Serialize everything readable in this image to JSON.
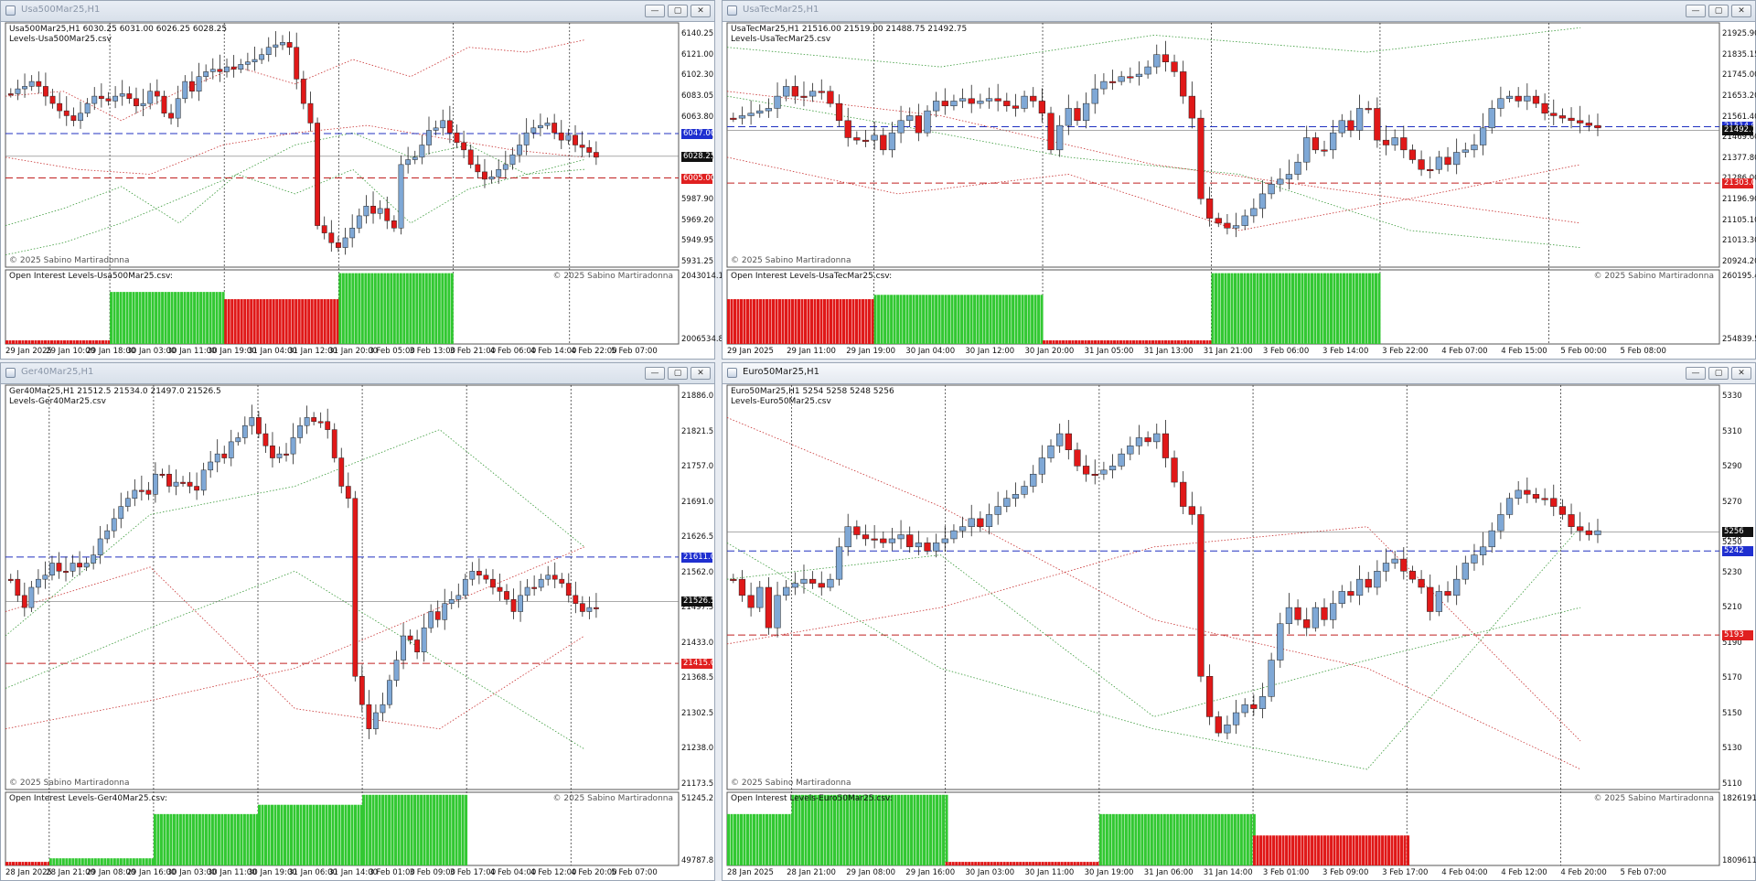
{
  "app": {
    "background": "#e8ecf2",
    "up_color": "#32c832",
    "down_color": "#e01818",
    "candle_up": "#7fa8d6"
  },
  "windows": [
    {
      "id": "usa500",
      "title": "Usa500Mar25,H1",
      "active": false,
      "price_header": "Usa500Mar25,H1  6030.25 6031.00 6026.25 6028.25",
      "levels_label": "Levels-Usa500Mar25.csv",
      "copyright": "© 2025 Sabino Martiradonna",
      "oi_label": "Open Interest Levels-Usa500Mar25.csv:",
      "oi_copyright": "© 2025 Sabino Martiradonna",
      "price_scale": [
        "6140.25",
        "6121.00",
        "6102.30",
        "6083.05",
        "6063.80",
        "6044.55",
        "6025.30",
        "6005.00",
        "5987.90",
        "5969.20",
        "5949.95",
        "5931.25"
      ],
      "oi_scale": [
        "2043014.1",
        "2006534.8"
      ],
      "tags": [
        {
          "text": "6047.00",
          "color": "blue",
          "pos": 0.453
        },
        {
          "text": "6028.25",
          "color": "black",
          "pos": 0.546
        },
        {
          "text": "6005.00",
          "color": "red",
          "pos": 0.635
        }
      ],
      "time_labels": [
        "29 Jan 2025",
        "29 Jan 10:00",
        "29 Jan 18:00",
        "30 Jan 03:00",
        "30 Jan 11:00",
        "30 Jan 19:00",
        "31 Jan 04:00",
        "31 Jan 12:00",
        "31 Jan 20:00",
        "3 Feb 05:00",
        "3 Feb 13:00",
        "3 Feb 21:00",
        "4 Feb 06:00",
        "4 Feb 14:00",
        "4 Feb 22:00",
        "5 Feb 07:00"
      ],
      "session_lines": [
        0.155,
        0.325,
        0.495,
        0.665,
        0.838
      ],
      "blue_dash": 0.453,
      "red_dash": 0.635,
      "current_line": 0.546,
      "oi_bars": [
        {
          "from": 0.0,
          "to": 0.155,
          "color": "red",
          "level": 0.05
        },
        {
          "from": 0.155,
          "to": 0.325,
          "color": "green",
          "level": 0.72
        },
        {
          "from": 0.325,
          "to": 0.495,
          "color": "red",
          "level": 0.62
        },
        {
          "from": 0.495,
          "to": 0.665,
          "color": "green",
          "level": 0.98
        }
      ],
      "segments": [
        [
          0.83,
          0.76,
          0.67,
          0.82,
          0.62,
          0.7,
          0.6,
          0.82,
          0.68,
          0.62,
          0.6
        ],
        [
          0.3,
          0.28,
          0.4,
          0.28,
          0.18,
          0.25,
          0.15,
          0.22,
          0.1,
          0.12,
          0.07
        ],
        [
          0.95,
          0.9,
          0.82,
          0.72,
          0.62,
          0.5,
          0.45,
          0.55,
          0.5,
          0.62,
          0.56
        ],
        [
          0.55,
          0.6,
          0.62,
          0.5,
          0.45,
          0.42,
          0.47,
          0.52,
          0.55
        ]
      ],
      "candles": [
        0.29,
        0.27,
        0.26,
        0.24,
        0.26,
        0.3,
        0.33,
        0.36,
        0.38,
        0.4,
        0.37,
        0.33,
        0.3,
        0.31,
        0.32,
        0.3,
        0.29,
        0.31,
        0.34,
        0.33,
        0.28,
        0.3,
        0.37,
        0.39,
        0.31,
        0.24,
        0.28,
        0.22,
        0.2,
        0.19,
        0.2,
        0.18,
        0.19,
        0.17,
        0.16,
        0.15,
        0.13,
        0.1,
        0.09,
        0.08,
        0.1,
        0.23,
        0.33,
        0.41,
        0.83,
        0.86,
        0.9,
        0.92,
        0.88,
        0.84,
        0.79,
        0.75,
        0.78,
        0.76,
        0.81,
        0.84,
        0.58,
        0.56,
        0.55,
        0.5,
        0.44,
        0.43,
        0.4,
        0.45,
        0.49,
        0.52,
        0.58,
        0.61,
        0.64,
        0.63,
        0.6,
        0.58,
        0.54,
        0.5,
        0.45,
        0.43,
        0.42,
        0.41,
        0.45,
        0.48,
        0.46,
        0.5,
        0.51,
        0.53,
        0.55
      ]
    },
    {
      "id": "usatec",
      "title": "UsaTecMar25,H1",
      "active": false,
      "price_header": "UsaTecMar25,H1  21516.00 21519.00 21488.75 21492.75",
      "levels_label": "Levels-UsaTecMar25.csv",
      "copyright": "© 2025 Sabino Martiradonna",
      "oi_label": "Open Interest Levels-UsaTecMar25.csv:",
      "oi_copyright": "© 2025 Sabino Martiradonna",
      "price_scale": [
        "21925.90",
        "21835.15",
        "21745.00",
        "21653.20",
        "21561.40",
        "21469.60",
        "21377.80",
        "21286.00",
        "21196.90",
        "21105.10",
        "21013.30",
        "20924.20"
      ],
      "oi_scale": [
        "260195.45",
        "254839.55"
      ],
      "tags": [
        {
          "text": "21514.00",
          "color": "blue",
          "pos": 0.425
        },
        {
          "text": "21492.75",
          "color": "black",
          "pos": 0.44
        },
        {
          "text": "21303.00",
          "color": "red",
          "pos": 0.656
        }
      ],
      "time_labels": [
        "29 Jan 2025",
        "29 Jan 11:00",
        "29 Jan 19:00",
        "30 Jan 04:00",
        "30 Jan 12:00",
        "30 Jan 20:00",
        "31 Jan 05:00",
        "31 Jan 13:00",
        "31 Jan 21:00",
        "3 Feb 06:00",
        "3 Feb 14:00",
        "3 Feb 22:00",
        "4 Feb 07:00",
        "4 Feb 15:00",
        "5 Feb 00:00",
        "5 Feb 08:00"
      ],
      "session_lines": [
        0.148,
        0.318,
        0.488,
        0.658,
        0.828
      ],
      "blue_dash": 0.425,
      "red_dash": 0.656,
      "current_line": 0.44,
      "oi_bars": [
        {
          "from": 0.0,
          "to": 0.148,
          "color": "red",
          "level": 0.62
        },
        {
          "from": 0.148,
          "to": 0.318,
          "color": "green",
          "level": 0.68
        },
        {
          "from": 0.318,
          "to": 0.488,
          "color": "red",
          "level": 0.05
        },
        {
          "from": 0.488,
          "to": 0.658,
          "color": "green",
          "level": 0.98
        }
      ],
      "segments": [
        [
          0.1,
          0.18,
          0.05,
          0.12,
          0.02
        ],
        [
          0.55,
          0.7,
          0.62,
          0.85,
          0.72,
          0.58
        ],
        [
          0.3,
          0.42,
          0.55,
          0.62,
          0.85,
          0.92
        ],
        [
          0.28,
          0.38,
          0.58,
          0.7,
          0.82
        ]
      ],
      "candles": [
        0.39,
        0.38,
        0.37,
        0.36,
        0.35,
        0.3,
        0.26,
        0.3,
        0.3,
        0.28,
        0.28,
        0.33,
        0.4,
        0.47,
        0.48,
        0.48,
        0.46,
        0.52,
        0.45,
        0.4,
        0.38,
        0.45,
        0.36,
        0.32,
        0.34,
        0.32,
        0.31,
        0.33,
        0.32,
        0.31,
        0.32,
        0.34,
        0.35,
        0.3,
        0.32,
        0.37,
        0.52,
        0.42,
        0.35,
        0.4,
        0.33,
        0.27,
        0.24,
        0.24,
        0.22,
        0.22,
        0.21,
        0.18,
        0.13,
        0.16,
        0.2,
        0.3,
        0.39,
        0.72,
        0.8,
        0.82,
        0.84,
        0.83,
        0.79,
        0.76,
        0.7,
        0.66,
        0.64,
        0.62,
        0.57,
        0.47,
        0.52,
        0.52,
        0.45,
        0.4,
        0.44,
        0.35,
        0.35,
        0.48,
        0.5,
        0.47,
        0.52,
        0.56,
        0.6,
        0.6,
        0.55,
        0.58,
        0.53,
        0.52,
        0.5,
        0.43,
        0.35,
        0.31,
        0.3,
        0.32,
        0.3,
        0.33,
        0.37,
        0.38,
        0.39,
        0.4,
        0.41,
        0.42,
        0.43
      ]
    },
    {
      "id": "ger40",
      "title": "Ger40Mar25,H1",
      "active": false,
      "price_header": "Ger40Mar25,H1  21512.5 21534.0 21497.0 21526.5",
      "levels_label": "Levels-Ger40Mar25.csv",
      "copyright": "© 2025 Sabino Martiradonna",
      "oi_label": "Open Interest Levels-Ger40Mar25.csv:",
      "oi_copyright": "© 2025 Sabino Martiradonna",
      "price_scale": [
        "21886.0",
        "21821.5",
        "21757.0",
        "21691.0",
        "21626.5",
        "21562.0",
        "21497.5",
        "21433.0",
        "21368.5",
        "21302.5",
        "21238.0",
        "21173.5"
      ],
      "oi_scale": [
        "51245.2",
        "49787.8"
      ],
      "tags": [
        {
          "text": "21611.0",
          "color": "blue",
          "pos": 0.425
        },
        {
          "text": "21526.5",
          "color": "black",
          "pos": 0.535
        },
        {
          "text": "21415.0",
          "color": "red",
          "pos": 0.688
        }
      ],
      "time_labels": [
        "28 Jan 2025",
        "28 Jan 21:00",
        "29 Jan 08:00",
        "29 Jan 16:00",
        "30 Jan 03:00",
        "30 Jan 11:00",
        "30 Jan 19:00",
        "31 Jan 06:00",
        "31 Jan 14:00",
        "3 Feb 01:00",
        "3 Feb 09:00",
        "3 Feb 17:00",
        "4 Feb 04:00",
        "4 Feb 12:00",
        "4 Feb 20:00",
        "5 Feb 07:00"
      ],
      "session_lines": [
        0.065,
        0.22,
        0.375,
        0.53,
        0.685,
        0.84
      ],
      "blue_dash": 0.425,
      "red_dash": 0.688,
      "current_line": 0.535,
      "oi_bars": [
        {
          "from": 0.0,
          "to": 0.065,
          "color": "red",
          "level": 0.05
        },
        {
          "from": 0.065,
          "to": 0.22,
          "color": "green",
          "level": 0.1
        },
        {
          "from": 0.22,
          "to": 0.375,
          "color": "green",
          "level": 0.72
        },
        {
          "from": 0.375,
          "to": 0.53,
          "color": "green",
          "level": 0.85
        },
        {
          "from": 0.53,
          "to": 0.685,
          "color": "green",
          "level": 0.99
        }
      ],
      "segments": [
        [
          0.62,
          0.32,
          0.25,
          0.11,
          0.4
        ],
        [
          0.85,
          0.78,
          0.7,
          0.55,
          0.4
        ],
        [
          0.75,
          0.6,
          0.46,
          0.68,
          0.9
        ],
        [
          0.56,
          0.45,
          0.8,
          0.85,
          0.62
        ]
      ],
      "candles": [
        0.48,
        0.52,
        0.55,
        0.5,
        0.48,
        0.47,
        0.44,
        0.46,
        0.46,
        0.44,
        0.45,
        0.44,
        0.42,
        0.38,
        0.36,
        0.33,
        0.3,
        0.28,
        0.26,
        0.26,
        0.27,
        0.22,
        0.22,
        0.25,
        0.24,
        0.24,
        0.25,
        0.26,
        0.21,
        0.19,
        0.17,
        0.18,
        0.14,
        0.13,
        0.1,
        0.08,
        0.12,
        0.15,
        0.18,
        0.17,
        0.17,
        0.13,
        0.1,
        0.08,
        0.09,
        0.09,
        0.11,
        0.18,
        0.25,
        0.28,
        0.72,
        0.79,
        0.85,
        0.81,
        0.79,
        0.73,
        0.68,
        0.62,
        0.63,
        0.66,
        0.6,
        0.56,
        0.58,
        0.54,
        0.53,
        0.52,
        0.48,
        0.46,
        0.47,
        0.48,
        0.5,
        0.51,
        0.53,
        0.56,
        0.52,
        0.5,
        0.5,
        0.48,
        0.47,
        0.48,
        0.49,
        0.52,
        0.54,
        0.56,
        0.55,
        0.55
      ]
    },
    {
      "id": "euro50",
      "title": "Euro50Mar25,H1",
      "active": true,
      "price_header": "Euro50Mar25,H1  5254 5258 5248 5256",
      "levels_label": "Levels-Euro50Mar25.csv",
      "copyright": "© 2025 Sabino Martiradonna",
      "oi_label": "Open Interest Levels-Euro50Mar25.csv:",
      "oi_copyright": "© 2025 Sabino Martiradonna",
      "price_scale": [
        "5330",
        "5310",
        "5290",
        "5270",
        "5250",
        "5230",
        "5210",
        "5190",
        "5170",
        "5150",
        "5130",
        "5110"
      ],
      "oi_scale": [
        "1826191",
        "1809611"
      ],
      "tags": [
        {
          "text": "5256",
          "color": "black",
          "pos": 0.363
        },
        {
          "text": "5250",
          "color": "none",
          "pos": 0.39
        },
        {
          "text": "5242",
          "color": "blue",
          "pos": 0.41
        },
        {
          "text": "5193",
          "color": "red",
          "pos": 0.618
        }
      ],
      "time_labels": [
        "28 Jan 2025",
        "28 Jan 21:00",
        "29 Jan 08:00",
        "29 Jan 16:00",
        "30 Jan 03:00",
        "30 Jan 11:00",
        "30 Jan 19:00",
        "31 Jan 06:00",
        "31 Jan 14:00",
        "3 Feb 01:00",
        "3 Feb 09:00",
        "3 Feb 17:00",
        "4 Feb 04:00",
        "4 Feb 12:00",
        "4 Feb 20:00",
        "5 Feb 07:00"
      ],
      "session_lines": [
        0.065,
        0.22,
        0.375,
        0.53,
        0.685,
        0.84
      ],
      "blue_dash": 0.41,
      "red_dash": 0.618,
      "current_line": 0.363,
      "oi_bars": [
        {
          "from": 0.0,
          "to": 0.065,
          "color": "green",
          "level": 0.72
        },
        {
          "from": 0.065,
          "to": 0.22,
          "color": "green",
          "level": 0.99
        },
        {
          "from": 0.22,
          "to": 0.375,
          "color": "red",
          "level": 0.05
        },
        {
          "from": 0.375,
          "to": 0.53,
          "color": "green",
          "level": 0.72
        },
        {
          "from": 0.53,
          "to": 0.685,
          "color": "red",
          "level": 0.42
        }
      ],
      "segments": [
        [
          0.48,
          0.42,
          0.82,
          0.68,
          0.55
        ],
        [
          0.64,
          0.55,
          0.4,
          0.35,
          0.88
        ],
        [
          0.39,
          0.7,
          0.85,
          0.95,
          0.35
        ],
        [
          0.08,
          0.3,
          0.58,
          0.7,
          0.95
        ]
      ],
      "candles": [
        0.48,
        0.52,
        0.55,
        0.5,
        0.6,
        0.52,
        0.5,
        0.49,
        0.48,
        0.49,
        0.5,
        0.48,
        0.4,
        0.35,
        0.37,
        0.38,
        0.38,
        0.39,
        0.38,
        0.37,
        0.4,
        0.39,
        0.41,
        0.39,
        0.38,
        0.36,
        0.35,
        0.33,
        0.35,
        0.32,
        0.3,
        0.28,
        0.27,
        0.25,
        0.22,
        0.18,
        0.15,
        0.12,
        0.16,
        0.2,
        0.22,
        0.22,
        0.21,
        0.2,
        0.17,
        0.15,
        0.13,
        0.14,
        0.12,
        0.18,
        0.24,
        0.3,
        0.32,
        0.72,
        0.82,
        0.86,
        0.84,
        0.81,
        0.79,
        0.8,
        0.77,
        0.68,
        0.59,
        0.55,
        0.58,
        0.6,
        0.55,
        0.58,
        0.54,
        0.51,
        0.52,
        0.48,
        0.5,
        0.46,
        0.44,
        0.43,
        0.46,
        0.48,
        0.5,
        0.56,
        0.51,
        0.52,
        0.48,
        0.44,
        0.42,
        0.4,
        0.36,
        0.32,
        0.28,
        0.26,
        0.27,
        0.28,
        0.28,
        0.3,
        0.32,
        0.35,
        0.36,
        0.37,
        0.36
      ]
    }
  ]
}
